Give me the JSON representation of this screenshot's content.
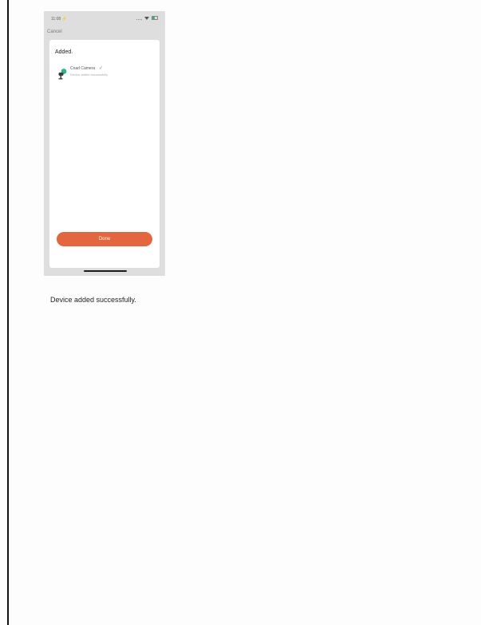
{
  "figure": {
    "status_bar": {
      "time": "11:08 ⚡",
      "icons": [
        "signal-icon",
        "wifi-icon",
        "battery-icon"
      ]
    },
    "nav": {
      "cancel_label": "Cancel"
    },
    "sheet": {
      "title": "Added.",
      "device": {
        "name": "Cnad Camera",
        "status": "Device added successfully",
        "icon": "camera-icon",
        "check_icon": "check-icon"
      },
      "done_label": "Done"
    }
  },
  "caption": "Device added successfully.",
  "colors": {
    "accent": "#e4663f",
    "badge_green": "#2fb37f",
    "phone_background": "#dedede"
  }
}
